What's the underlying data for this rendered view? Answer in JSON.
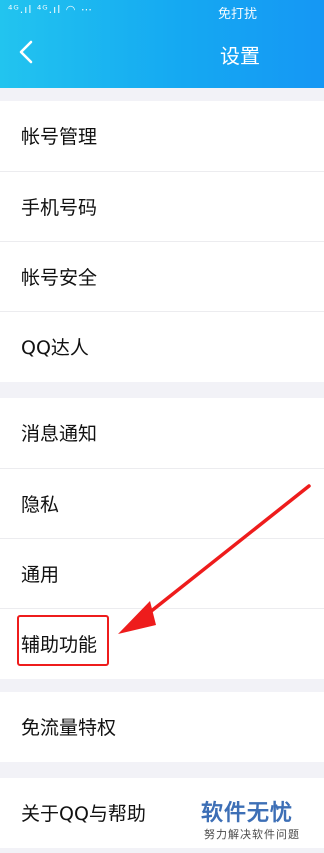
{
  "status_bar": {
    "signal_text": "⁴ᴳ.ıl ⁴ᴳ.ıl ◠ ⋯",
    "right_text": "免打扰"
  },
  "header": {
    "title": "设置"
  },
  "sections": [
    {
      "items": [
        {
          "label": "帐号管理"
        },
        {
          "label": "手机号码"
        },
        {
          "label": "帐号安全"
        },
        {
          "label": "QQ达人"
        }
      ]
    },
    {
      "items": [
        {
          "label": "消息通知"
        },
        {
          "label": "隐私"
        },
        {
          "label": "通用"
        },
        {
          "label": "辅助功能"
        }
      ]
    },
    {
      "items": [
        {
          "label": "免流量特权"
        }
      ]
    },
    {
      "items": [
        {
          "label": "关于QQ与帮助"
        }
      ]
    }
  ],
  "annotation": {
    "highlight_color": "#ee1c1c"
  },
  "watermark": {
    "title": "软件无忧",
    "subtitle": "努力解决软件问题"
  }
}
